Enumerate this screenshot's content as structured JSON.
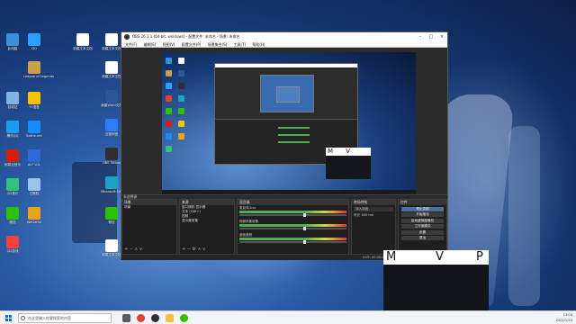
{
  "desktop": {
    "icons": [
      {
        "label": "此电脑",
        "icon": "computer-icon",
        "color": "#3a8fd9"
      },
      {
        "label": "League of Legends",
        "icon": "lol-icon",
        "color": "#c9a14b"
      },
      {
        "label": "回收站",
        "icon": "recycle-bin-icon",
        "color": "#7fb3e0"
      },
      {
        "label": "QQ",
        "icon": "qq-icon",
        "color": "#2aa1ff"
      },
      {
        "label": "新建文本文档",
        "icon": "text-document-icon",
        "color": "#ffffff"
      },
      {
        "label": "新建文本文档",
        "icon": "text-document-icon",
        "color": "#ffffff"
      },
      {
        "label": "新建文本文档",
        "icon": "text-document-icon",
        "color": "#ffffff"
      },
      {
        "label": "新建Word文档",
        "icon": "word-icon",
        "color": "#2b5797"
      },
      {
        "label": "百度网盘",
        "icon": "cloud-icon",
        "color": "#2e7df6"
      },
      {
        "label": "OBS Studio",
        "icon": "obs-icon",
        "color": "#302e31"
      },
      {
        "label": "Microsoft Edge",
        "icon": "edge-icon",
        "color": "#1fa0c7"
      },
      {
        "label": "微信",
        "icon": "wechat-icon",
        "color": "#2dc100"
      },
      {
        "label": "新建文本文档",
        "icon": "text-document-icon",
        "color": "#ffffff"
      },
      {
        "label": "腾讯QQ",
        "icon": "qq-icon",
        "color": "#1e9bf0"
      },
      {
        "label": "YY语音",
        "icon": "yy-icon",
        "color": "#f5c400"
      },
      {
        "label": "网易云音乐",
        "icon": "music-icon",
        "color": "#d81e06"
      },
      {
        "label": "Battle.net",
        "icon": "battlenet-icon",
        "color": "#148eff"
      },
      {
        "label": "ALP LOL",
        "icon": "lol-helper-icon",
        "color": "#2f6bd8"
      },
      {
        "label": "QQ音乐",
        "icon": "qq-music-icon",
        "color": "#31c27c"
      },
      {
        "label": "微信",
        "icon": "wechat-icon",
        "color": "#2dc100"
      },
      {
        "label": "已删除",
        "icon": "recycle-bin-icon",
        "color": "#9ac3ea"
      },
      {
        "label": "QQ游戏",
        "icon": "qq-game-icon",
        "color": "#f44336"
      },
      {
        "label": "WeGame",
        "icon": "wegame-icon",
        "color": "#e8a317"
      }
    ]
  },
  "obs": {
    "title": "OBS 26.1.1 (64-bit, windows) - 配置文件: 未命名 - 场景: 未命名",
    "menu": [
      "文件(F)",
      "编辑(E)",
      "视图(V)",
      "配置文件(P)",
      "场景集合(S)",
      "工具(T)",
      "帮助(H)"
    ],
    "preview_camera_letters": "M V P",
    "dock_bar_label": "未选择源",
    "panels": {
      "scenes": {
        "title": "场景",
        "items": [
          "场景"
        ]
      },
      "sources": {
        "title": "来源",
        "items": [
          "窗口捕获 显示器",
          "文本 (GDI+)",
          "视频",
          "显示器采集"
        ]
      },
      "mixer": {
        "title": "混音器",
        "channels": [
          {
            "name": "麦克风/Aux",
            "db": "0.0 dB"
          },
          {
            "name": "视频采集设备",
            "db": "0.0 dB"
          },
          {
            "name": "桌面音频",
            "db": "0.0 dB"
          }
        ]
      },
      "transitions": {
        "title": "转场特效",
        "type": "淡入淡出",
        "duration_label": "时长",
        "duration": "300 ms"
      },
      "controls": {
        "title": "控件",
        "buttons": [
          "停止录制",
          "开始推流",
          "启动虚拟摄像机",
          "工作室模式",
          "设置",
          "退出"
        ]
      }
    },
    "status": "LIVE: 00:00:00   REC: 00:00:04   CPU: 1.7%, 30.00 fps"
  },
  "camera_overlay": {
    "letters": [
      "M",
      "V",
      "P"
    ]
  },
  "taskbar": {
    "search_placeholder": "在这里输入你要搜索的内容",
    "time": "13:04",
    "date": "2021/1/23",
    "apps": [
      {
        "icon": "task-view-icon",
        "color": "#5a5a5a"
      },
      {
        "icon": "chrome-icon",
        "color": "#e34133"
      },
      {
        "icon": "obs-icon",
        "color": "#302e31"
      },
      {
        "icon": "folder-icon",
        "color": "#f3c13a"
      },
      {
        "icon": "wechat-icon",
        "color": "#2dc100"
      }
    ]
  }
}
